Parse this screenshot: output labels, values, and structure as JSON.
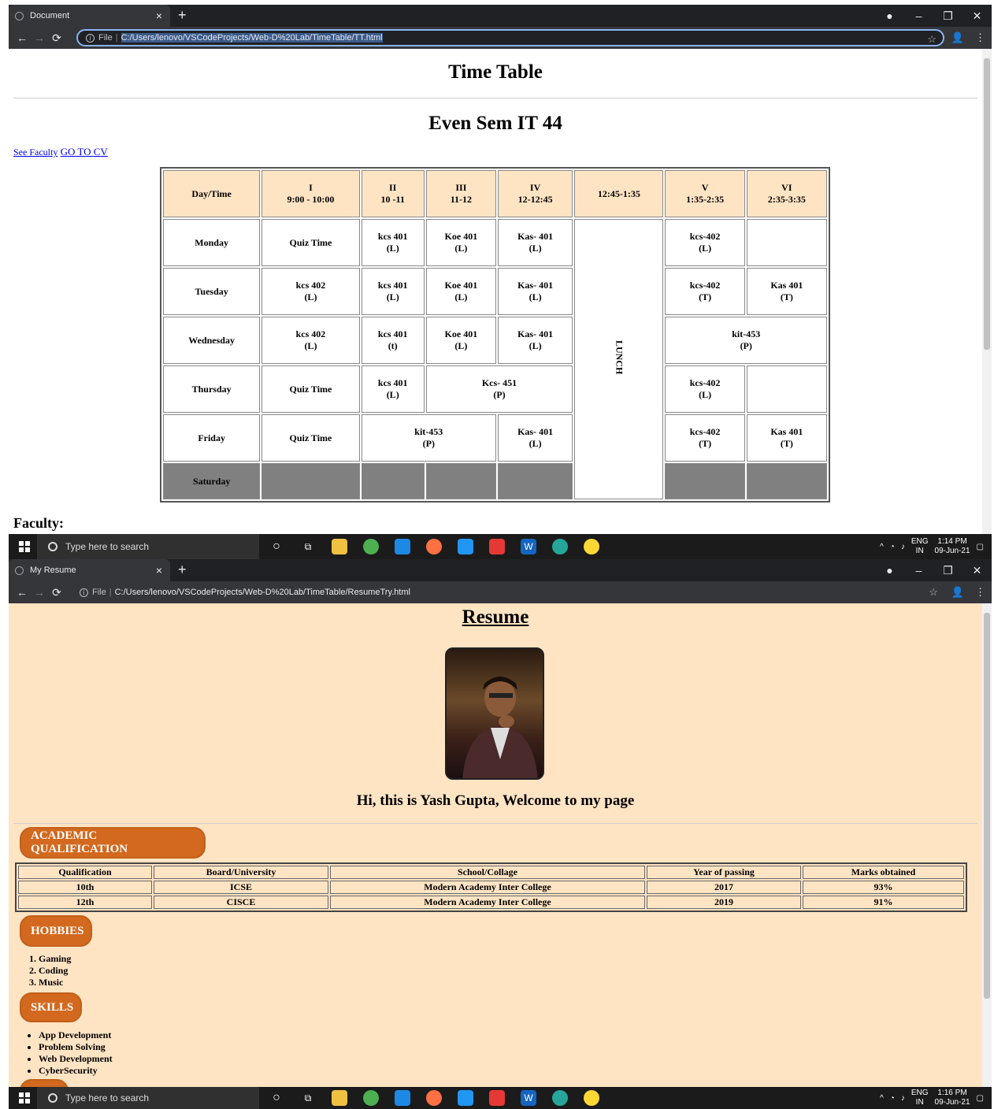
{
  "window1": {
    "tab_title": "Document",
    "file_label": "File",
    "url": "C:/Users/lenovo/VSCodeProjects/Web-D%20Lab/TimeTable/TT.html",
    "page_title": "Time Table",
    "subtitle": "Even Sem IT 44",
    "link_faculty": "See Faculty",
    "link_cv": "GO TO CV",
    "faculty_heading": "Faculty:",
    "timetable": {
      "header": [
        [
          "Day/Time"
        ],
        [
          "I",
          "9:00 - 10:00"
        ],
        [
          "II",
          "10 -11"
        ],
        [
          "III",
          "11-12"
        ],
        [
          "IV",
          "12-12:45"
        ],
        [
          "12:45-1:35"
        ],
        [
          "V",
          "1:35-2:35"
        ],
        [
          "VI",
          "2:35-3:35"
        ]
      ],
      "lunch": "LUNCH",
      "days": [
        "Monday",
        "Tuesday",
        "Wednesday",
        "Thursday",
        "Friday",
        "Saturday"
      ],
      "monday": [
        "Quiz Time",
        "kcs 401",
        "(L)",
        "Koe 401",
        "(L)",
        "Kas- 401",
        "(L)",
        "kcs-402",
        "(L)"
      ],
      "tuesday": [
        "kcs 402",
        "(L)",
        "kcs 401",
        "(L)",
        "Koe 401",
        "(L)",
        "Kas- 401",
        "(L)",
        "kcs-402",
        "(T)",
        "Kas 401",
        "(T)"
      ],
      "wednesday": [
        "kcs 402",
        "(L)",
        "kcs 401",
        "(t)",
        "Koe 401",
        "(L)",
        "Kas- 401",
        "(L)",
        "kit-453",
        "(P)"
      ],
      "thursday": [
        "Quiz Time",
        "kcs 401",
        "(L)",
        "Kcs- 451",
        "(P)",
        "kcs-402",
        "(L)"
      ],
      "friday": [
        "Quiz Time",
        "kit-453",
        "(P)",
        "Kas- 401",
        "(L)",
        "kcs-402",
        "(T)",
        "Kas 401",
        "(T)"
      ]
    }
  },
  "window2": {
    "tab_title": "My Resume",
    "file_label": "File",
    "url": "C:/Users/lenovo/VSCodeProjects/Web-D%20Lab/TimeTable/ResumeTry.html",
    "page_title": "Resume",
    "greeting": "Hi, this is Yash Gupta, Welcome to my page",
    "sections": {
      "academic": "ACADEMIC QUALIFICATION",
      "hobbies": "HOBBIES",
      "skills": "SKILLS"
    },
    "academic_table": {
      "headers": [
        "Qualification",
        "Board/University",
        "School/Collage",
        "Year of passing",
        "Marks obtained"
      ],
      "rows": [
        [
          "10th",
          "ICSE",
          "Modern Academy Inter College",
          "2017",
          "93%"
        ],
        [
          "12th",
          "CISCE",
          "Modern Academy Inter College",
          "2019",
          "91%"
        ]
      ]
    },
    "hobbies": [
      "1. Gaming",
      "2. Coding",
      "3. Music"
    ],
    "skills": [
      "App Development",
      "Problem Solving",
      "Web Development",
      "CyberSecurity"
    ]
  },
  "taskbar": {
    "search_placeholder": "Type here to search",
    "lang": "ENG",
    "region": "IN",
    "time1": "1:14 PM",
    "date1": "09-Jun-21",
    "time2": "1:16 PM",
    "date2": "09-Jun-21"
  },
  "colors": {
    "header_bg": "#ffe4c4",
    "pill": "#d2691e",
    "saturday": "#808080"
  }
}
